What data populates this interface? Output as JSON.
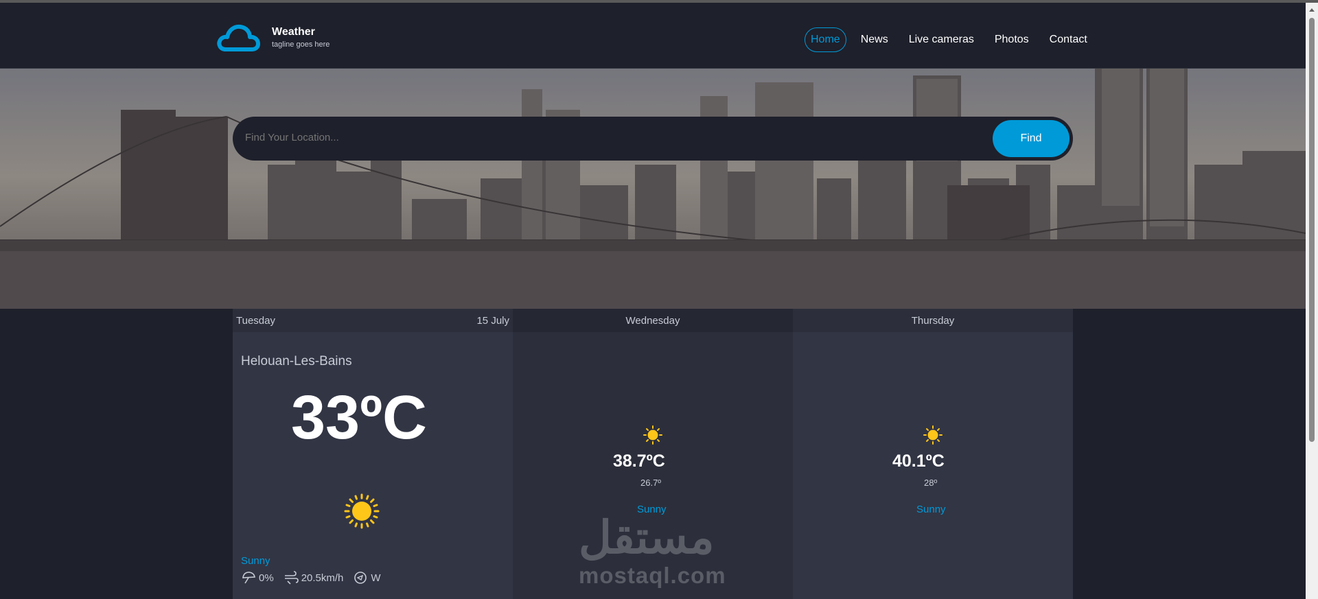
{
  "brand": {
    "title": "Weather",
    "tagline": "tagline goes here",
    "logo_icon": "cloud-icon",
    "accent": "#009ad8"
  },
  "nav": {
    "items": [
      {
        "label": "Home",
        "active": true
      },
      {
        "label": "News",
        "active": false
      },
      {
        "label": "Live cameras",
        "active": false
      },
      {
        "label": "Photos",
        "active": false
      },
      {
        "label": "Contact",
        "active": false
      }
    ]
  },
  "search": {
    "placeholder": "Find Your Location...",
    "button_label": "Find"
  },
  "forecast": {
    "today": {
      "day": "Tuesday",
      "date": "15 July",
      "location": "Helouan-Les-Bains",
      "temperature": "33ºC",
      "condition": "Sunny",
      "icon": "sun-icon",
      "rain": "0%",
      "wind_speed": "20.5km/h",
      "wind_direction": "W"
    },
    "days": [
      {
        "day": "Wednesday",
        "max": "38.7ºC",
        "min": "26.7º",
        "condition": "Sunny",
        "icon": "sun-icon"
      },
      {
        "day": "Thursday",
        "max": "40.1ºC",
        "min": "28º",
        "condition": "Sunny",
        "icon": "sun-icon"
      }
    ]
  },
  "watermark": {
    "arabic": "مستقل",
    "latin": "mostaql.com"
  },
  "colors": {
    "background": "#1e202b",
    "accent": "#009ad8",
    "sun": "#ffc61a",
    "text_muted": "#c8ccd6"
  }
}
